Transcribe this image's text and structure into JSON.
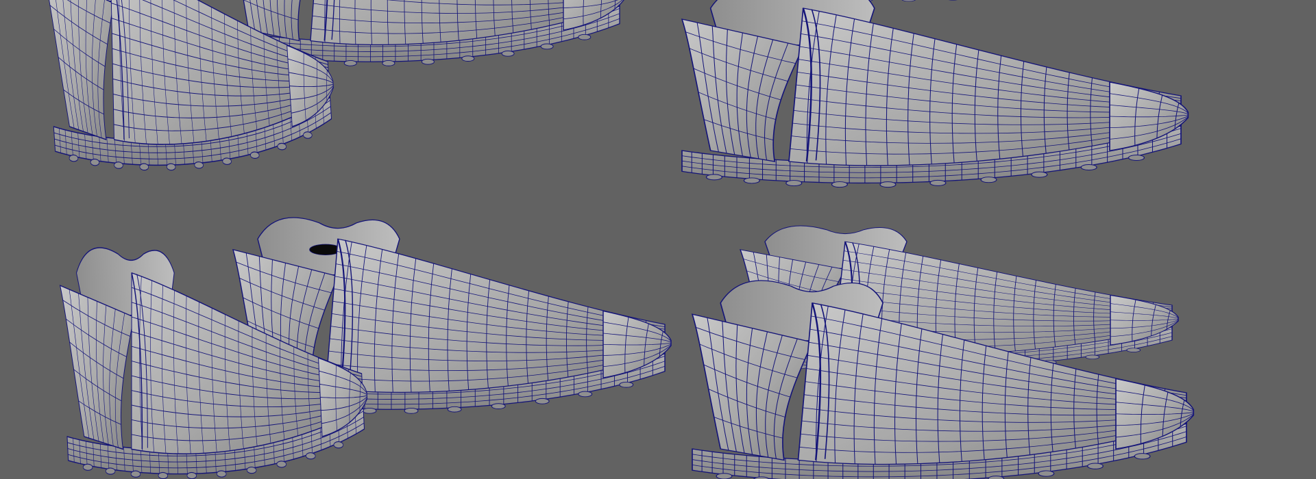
{
  "viewport": {
    "background_color": "#626262",
    "wire_color": "#141478",
    "surface_color": "#a6a6a6",
    "surface_light": "#c8c8c8",
    "surface_dark": "#7d7d7d",
    "interior_color": "#0a0a0a"
  },
  "views": [
    {
      "name": "top-left-pair",
      "shoes": 2
    },
    {
      "name": "top-right-pair",
      "shoes": 2
    },
    {
      "name": "bottom-left-pair",
      "shoes": 2
    },
    {
      "name": "bottom-right-pair",
      "shoes": 2
    }
  ]
}
